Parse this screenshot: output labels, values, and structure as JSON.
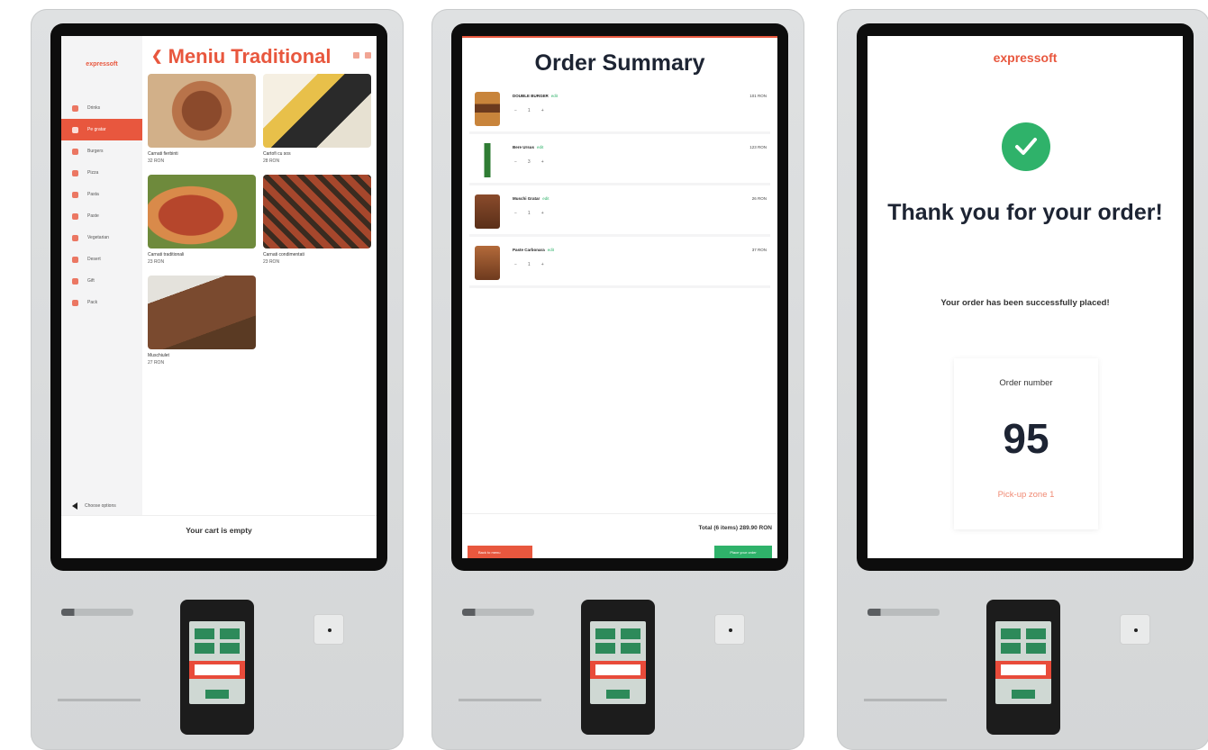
{
  "screen_menu": {
    "logo": "expressoft",
    "title": "Meniu Traditional",
    "nav": [
      {
        "label": "Drinks",
        "active": false
      },
      {
        "label": "Pe gratar",
        "active": true
      },
      {
        "label": "Burgers",
        "active": false
      },
      {
        "label": "Pizza",
        "active": false
      },
      {
        "label": "Pasta",
        "active": false
      },
      {
        "label": "Paste",
        "active": false
      },
      {
        "label": "Vegetarian",
        "active": false
      },
      {
        "label": "Desert",
        "active": false
      },
      {
        "label": "Gift",
        "active": false
      },
      {
        "label": "Pack",
        "active": false
      }
    ],
    "products": [
      {
        "name": "Carnati fierbinti",
        "price": "32 RON"
      },
      {
        "name": "Cartofi cu sos",
        "price": "28 RON"
      },
      {
        "name": "Carnati traditionali",
        "price": "23 RON"
      },
      {
        "name": "Carnati condimentati",
        "price": "23 RON"
      },
      {
        "name": "Muschiulet",
        "price": "27 RON"
      }
    ],
    "back_label": "Choose options",
    "cart_text": "Your cart is empty"
  },
  "screen_summary": {
    "title": "Order Summary",
    "items": [
      {
        "name": "DOUBLE BURGER",
        "edit": "edit",
        "price": "101 RON",
        "qty": "1"
      },
      {
        "name": "Bere Ursus",
        "edit": "edit",
        "price": "123 RON",
        "qty": "3"
      },
      {
        "name": "Muschi Gratar",
        "edit": "edit",
        "price": "26 RON",
        "qty": "1"
      },
      {
        "name": "Paste Carbonara",
        "edit": "edit",
        "price": "37 RON",
        "qty": "1"
      }
    ],
    "total": "Total (6 items)  289.90 RON",
    "back_button": "Back to menu",
    "place_button": "Place your order"
  },
  "screen_thanks": {
    "logo_part1": "expres",
    "logo_part2": "soft",
    "heading": "Thank you for your order!",
    "message": "Your order has been successfully placed!",
    "order_label": "Order number",
    "order_number": "95",
    "pickup": "Pick-up zone 1"
  },
  "colors": {
    "brand": "#e8573e",
    "success": "#2fb26a",
    "dark_text": "#1d2433"
  }
}
